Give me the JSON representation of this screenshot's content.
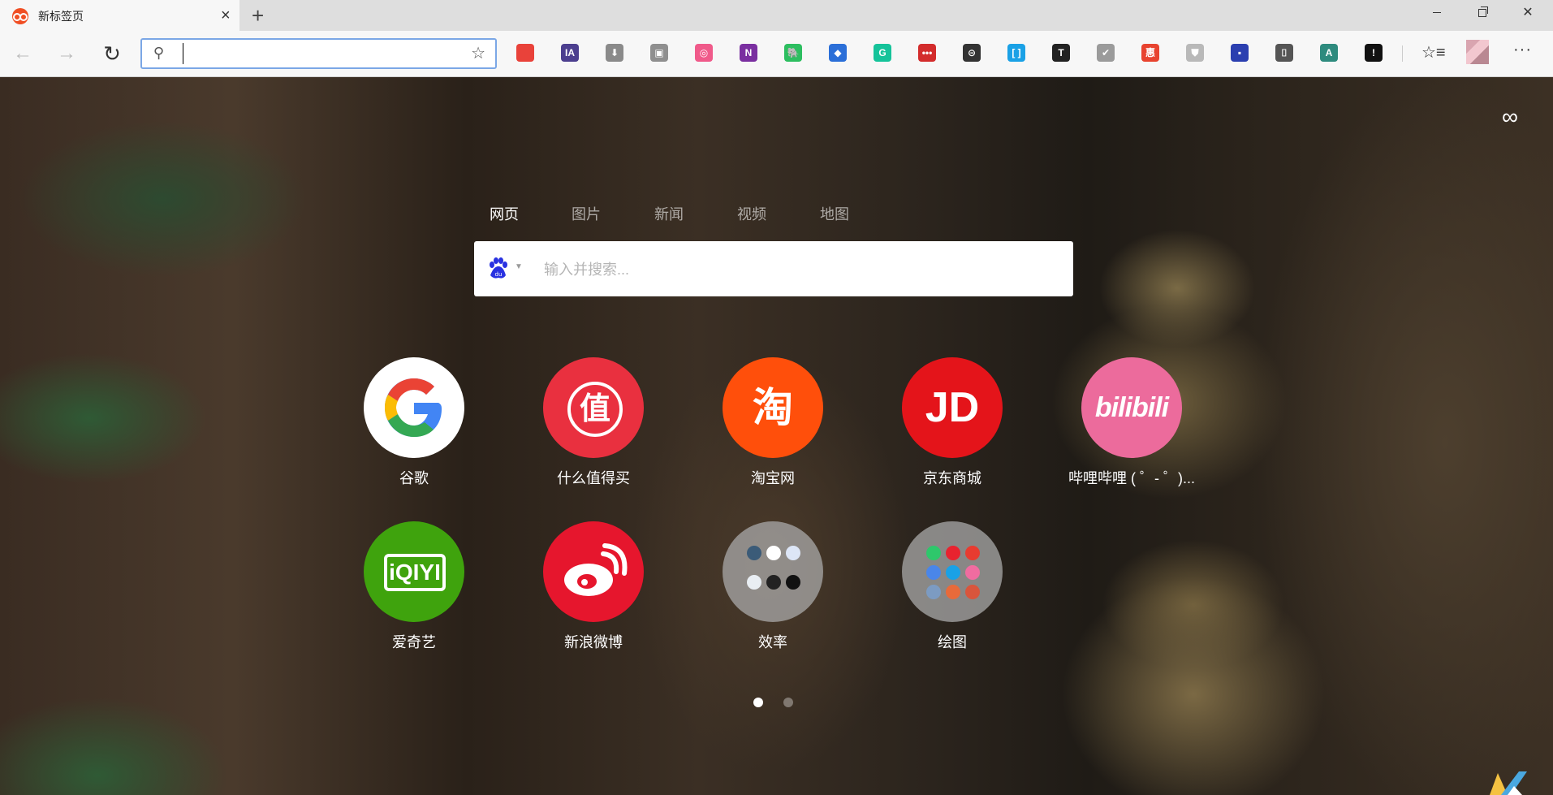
{
  "tab": {
    "title": "新标签页"
  },
  "addressbar": {
    "value": "",
    "placeholder": ""
  },
  "extensions": [
    {
      "name": "chrome-like-ext-icon",
      "color": "#e9423a",
      "text": ""
    },
    {
      "name": "ia-writer-ext-icon",
      "color": "#4c3f8f",
      "text": "IA"
    },
    {
      "name": "download-ext-icon",
      "color": "#8a8a8a",
      "text": "⬇"
    },
    {
      "name": "tabs-ext-icon",
      "color": "#8f8f8f",
      "text": "▣"
    },
    {
      "name": "pink-ext-icon",
      "color": "#f05a8a",
      "text": "◎"
    },
    {
      "name": "onenote-ext-icon",
      "color": "#7a2fa0",
      "text": "N"
    },
    {
      "name": "evernote-ext-icon",
      "color": "#2dbe60",
      "text": "🐘"
    },
    {
      "name": "blue-cap-ext-icon",
      "color": "#2b6fd8",
      "text": "◆"
    },
    {
      "name": "grammarly-ext-icon",
      "color": "#15c39a",
      "text": "G"
    },
    {
      "name": "red-dots-ext-icon",
      "color": "#d32c2c",
      "text": "•••"
    },
    {
      "name": "link-ext-icon",
      "color": "#333333",
      "text": "⊝"
    },
    {
      "name": "brackets-ext-icon",
      "color": "#1aa1e6",
      "text": "[ ]"
    },
    {
      "name": "text-ext-icon",
      "color": "#222222",
      "text": "T"
    },
    {
      "name": "check-ext-icon",
      "color": "#9b9b9b",
      "text": "✔"
    },
    {
      "name": "hui-ext-icon",
      "color": "#e8432f",
      "text": "惠"
    },
    {
      "name": "shield-ext-icon",
      "color": "#b9b9b9",
      "text": "⛊"
    },
    {
      "name": "blue-doc-ext-icon",
      "color": "#2b3fb0",
      "text": "▪"
    },
    {
      "name": "camera-ext-icon",
      "color": "#555555",
      "text": "⌷"
    },
    {
      "name": "translate-ext-icon",
      "color": "#2e8b7e",
      "text": "A"
    },
    {
      "name": "exclaim-ext-icon",
      "color": "#111111",
      "text": "!"
    }
  ],
  "search": {
    "tabs": [
      "网页",
      "图片",
      "新闻",
      "视频",
      "地图"
    ],
    "placeholder": "输入并搜索..."
  },
  "shortcuts": [
    {
      "label": "谷歌",
      "icon": "google-icon",
      "bg": "#ffffff"
    },
    {
      "label": "什么值得买",
      "icon": "smzdm-icon",
      "bg": "#e9303f"
    },
    {
      "label": "淘宝网",
      "icon": "taobao-icon",
      "bg": "#ff4f0b"
    },
    {
      "label": "京东商城",
      "icon": "jd-icon",
      "bg": "#e4141a"
    },
    {
      "label": "哔哩哔哩 ( ゜- ゜)...",
      "icon": "bilibili-icon",
      "bg": "#ec6b9c"
    },
    {
      "label": "爱奇艺",
      "icon": "iqiyi-icon",
      "bg": "#3fa30d"
    },
    {
      "label": "新浪微博",
      "icon": "weibo-icon",
      "bg": "#e6162d"
    },
    {
      "label": "效率",
      "icon": "efficiency-folder-icon",
      "bg": "#8d8d8d"
    },
    {
      "label": "绘图",
      "icon": "drawing-folder-icon",
      "bg": "#8d8d8d"
    }
  ],
  "pagination": {
    "count": 2,
    "active": 0
  },
  "colors": {
    "accent": "#7ba7e6",
    "baidu": "#2932e1"
  }
}
